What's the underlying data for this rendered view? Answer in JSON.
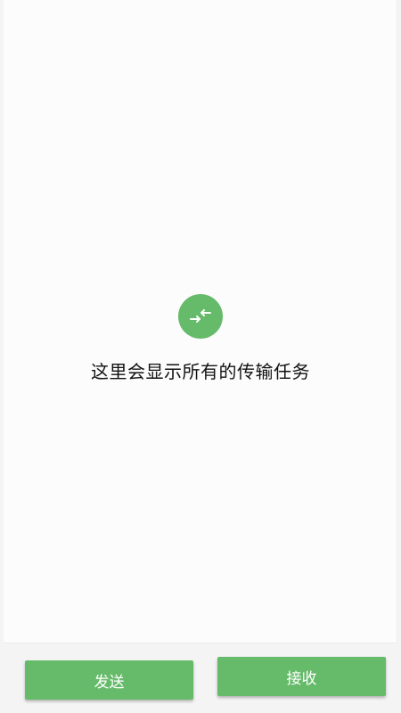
{
  "empty_state": {
    "icon": "transfer-arrows-icon",
    "message": "这里会显示所有的传输任务",
    "accent_color": "#66bb6a"
  },
  "actions": {
    "send_label": "发送",
    "receive_label": "接收"
  }
}
